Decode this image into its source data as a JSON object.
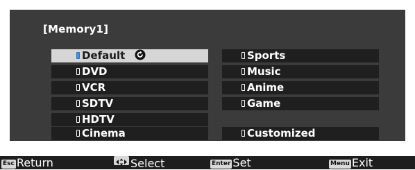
{
  "screen_title": "[Memory1]",
  "left_items": [
    {
      "label": "Default",
      "selected": true,
      "has_adjust_icon": true
    },
    {
      "label": "DVD",
      "selected": false
    },
    {
      "label": "VCR",
      "selected": false
    },
    {
      "label": "SDTV",
      "selected": false
    },
    {
      "label": "HDTV",
      "selected": false
    },
    {
      "label": "Cinema",
      "selected": false
    }
  ],
  "right_items": [
    {
      "label": "Sports"
    },
    {
      "label": "Music"
    },
    {
      "label": "Anime"
    },
    {
      "label": "Game"
    },
    {
      "label": "Customized"
    }
  ],
  "footer": {
    "esc_key": "Esc",
    "return_label": "Return",
    "select_label": "Select",
    "enter_key": "Enter",
    "set_label": "Set",
    "menu_key": "Menu",
    "exit_label": "Exit"
  },
  "colors": {
    "panel": "#3b3b3b",
    "item_bg": "#1f1f1f",
    "selected_bg": "#d6d6d6",
    "indicator_selected": "#4a8fe0"
  }
}
